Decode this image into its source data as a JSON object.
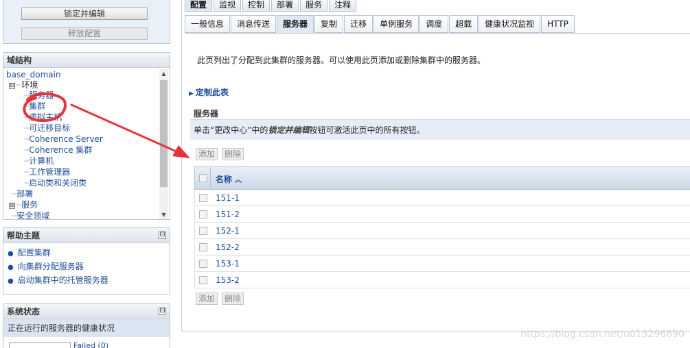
{
  "change_center": {
    "lock_label": "锁定并编辑",
    "release_label": "释放配置"
  },
  "domain_structure": {
    "title": "域结构",
    "nodes": [
      {
        "label": "base_domain"
      },
      {
        "label": "环境",
        "expander": "⊟"
      },
      {
        "label": "服务器"
      },
      {
        "label": "集群"
      },
      {
        "label": "虚拟主机"
      },
      {
        "label": "可迁移目标"
      },
      {
        "label": "Coherence Server"
      },
      {
        "label": "Coherence 集群"
      },
      {
        "label": "计算机"
      },
      {
        "label": "工作管理器"
      },
      {
        "label": "启动类和关闭类"
      },
      {
        "label": "部署"
      },
      {
        "label": "服务",
        "expander": "⊞"
      },
      {
        "label": "安全领域"
      }
    ]
  },
  "help_topics": {
    "title": "帮助主题",
    "collapse": "⊟",
    "items": [
      {
        "label": "配置集群"
      },
      {
        "label": "向集群分配服务器"
      },
      {
        "label": "启动集群中的托管服务器"
      }
    ]
  },
  "system_status": {
    "title": "系统状态",
    "collapse": "⊟",
    "subtitle": "正在运行的服务器的健康状况",
    "failed_label": "Failed (0)"
  },
  "main_tabs": [
    {
      "label": "配置",
      "active": true
    },
    {
      "label": "监视"
    },
    {
      "label": "控制"
    },
    {
      "label": "部署"
    },
    {
      "label": "服务"
    },
    {
      "label": "注释"
    }
  ],
  "sub_tabs": [
    {
      "label": "一般信息"
    },
    {
      "label": "消息传送"
    },
    {
      "label": "服务器",
      "active": true
    },
    {
      "label": "复制"
    },
    {
      "label": "迁移"
    },
    {
      "label": "单例服务"
    },
    {
      "label": "调度"
    },
    {
      "label": "超载"
    },
    {
      "label": "健康状况监视"
    },
    {
      "label": "HTTP"
    }
  ],
  "content": {
    "intro": "此页列出了分配到此集群的服务器。可以使用此页添加或删除集群中的服务器。",
    "customize_label": "定制此表",
    "section_title": "服务器",
    "hint_prefix": "单击“更改中心”中的",
    "hint_emphasis": "锁定并编辑",
    "hint_suffix": "按钮可激活此页中的所有按钮。",
    "add_label": "添加",
    "delete_label": "删除",
    "column_name": "名称",
    "rows": [
      "151-1",
      "151-2",
      "152-1",
      "152-2",
      "153-1",
      "153-2"
    ]
  },
  "watermark": "https://blog.csdn.net/u013296690",
  "colors": {
    "link": "#1f4e9a",
    "annotation_red": "#e8333a"
  },
  "icons": {
    "sort": "sort-ascending-icon",
    "collapse": "collapse-box-icon",
    "customize": "expand-triangle-icon"
  }
}
